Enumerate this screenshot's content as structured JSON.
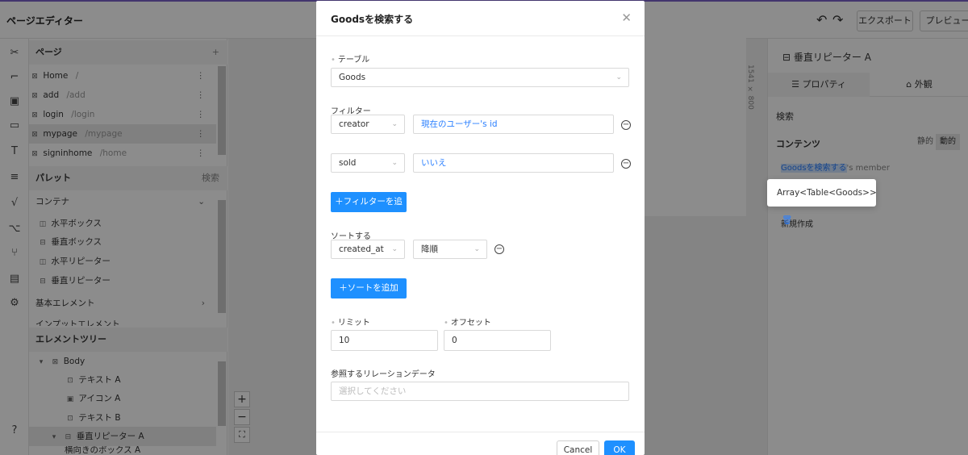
{
  "app": {
    "title": "ページエディター",
    "export_label": "エクスポート",
    "preview_label": "プレビュー"
  },
  "pages_panel": {
    "title": "ページ",
    "items": [
      {
        "name": "Home",
        "path": "/"
      },
      {
        "name": "add",
        "path": "/add"
      },
      {
        "name": "login",
        "path": "/login"
      },
      {
        "name": "mypage",
        "path": "/mypage"
      },
      {
        "name": "signinhome",
        "path": "/home"
      }
    ]
  },
  "palette": {
    "title": "パレット",
    "search_label": "検索",
    "container_label": "コンテナ",
    "items": [
      "水平ボックス",
      "垂直ボックス",
      "水平リピーター",
      "垂直リピーター"
    ],
    "basic_label": "基本エレメント",
    "input_label": "インプットエレメント"
  },
  "element_tree": {
    "title": "エレメントツリー",
    "body": "Body",
    "items": [
      "テキスト A",
      "アイコン A",
      "テキスト B",
      "垂直リピーター A",
      "横向きのボックス A"
    ]
  },
  "canvas": {
    "size_label": "1541 × 800"
  },
  "right_panel": {
    "title": "垂直リピーター A",
    "tab_props": "プロパティ",
    "tab_appearance": "外観",
    "search": "検索",
    "contents": "コンテンツ",
    "static": "静的",
    "dynamic": "動的",
    "binding_highlight": "Goodsを検索する",
    "binding_suffix": "'s member",
    "new_create": "新規作成",
    "popover_text": "Array<Table<Goods>>"
  },
  "modal": {
    "title": "Goodsを検索する",
    "table_label": "テーブル",
    "table_value": "Goods",
    "filter_label": "フィルター",
    "filters": [
      {
        "field": "creator",
        "value": "現在のユーザー's id"
      },
      {
        "field": "sold",
        "value": "いいえ"
      }
    ],
    "add_filter": "＋フィルターを追加",
    "sort_label": "ソートする",
    "sort_field": "created_at",
    "sort_order": "降順",
    "add_sort": "＋ソートを追加",
    "limit_label": "リミット",
    "limit_value": "10",
    "offset_label": "オフセット",
    "offset_value": "0",
    "relation_label": "参照するリレーションデータ",
    "relation_placeholder": "選択してください",
    "cancel": "Cancel",
    "ok": "OK"
  }
}
